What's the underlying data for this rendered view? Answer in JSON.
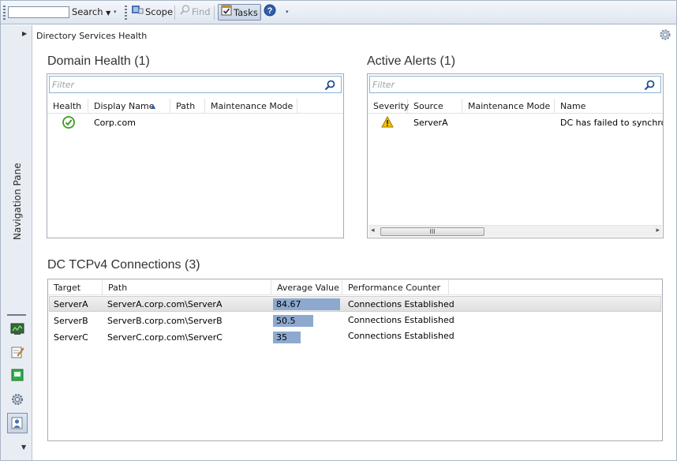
{
  "toolbar": {
    "search_label": "Search",
    "scope_label": "Scope",
    "find_label": "Find",
    "tasks_label": "Tasks",
    "help_icon": "help-icon"
  },
  "nav_pane": {
    "label": "Navigation Pane",
    "icons": [
      "monitoring-icon",
      "authoring-icon",
      "reporting-icon",
      "administration-icon",
      "my-workspace-icon"
    ]
  },
  "breadcrumb": "Directory Services Health",
  "domain_health": {
    "title": "Domain Health (1)",
    "filter_placeholder": "Filter",
    "columns": [
      "Health",
      "Display Name",
      "Path",
      "Maintenance Mode"
    ],
    "rows": [
      {
        "health": "healthy",
        "display_name": "Corp.com",
        "path": "",
        "maintenance_mode": ""
      }
    ]
  },
  "active_alerts": {
    "title": "Active Alerts (1)",
    "filter_placeholder": "Filter",
    "columns": [
      "Severity",
      "Source",
      "Maintenance Mode",
      "Name"
    ],
    "rows": [
      {
        "severity": "warning",
        "source": "ServerA",
        "maintenance_mode": "",
        "name": "DC has failed to synchroni"
      }
    ],
    "scroll_thumb": "III"
  },
  "connections": {
    "title": "DC TCPv4 Connections (3)",
    "columns": [
      "Target",
      "Path",
      "Average Value",
      "Performance Counter"
    ],
    "max_value": 100,
    "rows": [
      {
        "target": "ServerA",
        "path": "ServerA.corp.com\\ServerA",
        "value": 84.67,
        "value_label": "84.67",
        "counter": "Connections Established"
      },
      {
        "target": "ServerB",
        "path": "ServerB.corp.com\\ServerB",
        "value": 50.5,
        "value_label": "50.5",
        "counter": "Connections Established"
      },
      {
        "target": "ServerC",
        "path": "ServerC.corp.com\\ServerC",
        "value": 35,
        "value_label": "35",
        "counter": "Connections Established"
      }
    ]
  },
  "colors": {
    "bar": "#8ea9cf",
    "healthy": "#3a9d23",
    "warning": "#f2c200"
  }
}
